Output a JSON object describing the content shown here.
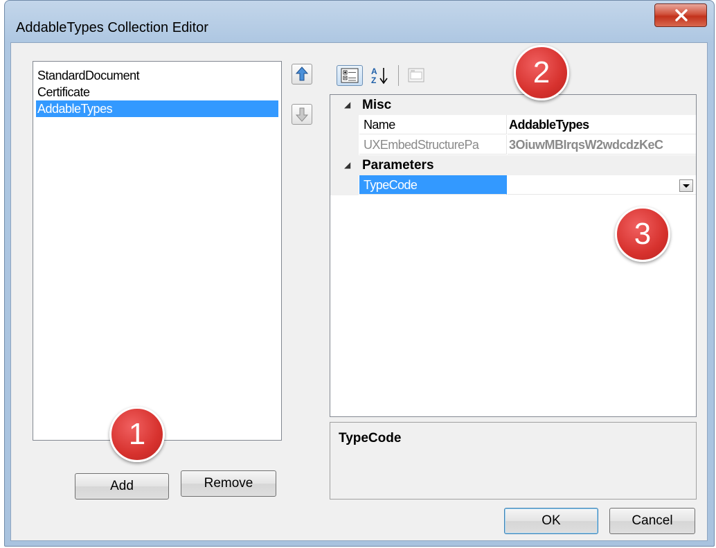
{
  "window": {
    "title": "AddableTypes Collection Editor",
    "close_icon": "close-icon"
  },
  "members": {
    "items": [
      {
        "label": "StandardDocument",
        "selected": false
      },
      {
        "label": "Certificate",
        "selected": false
      },
      {
        "label": "AddableTypes",
        "selected": true
      }
    ],
    "add_label": "Add",
    "remove_label": "Remove"
  },
  "property_grid": {
    "toolbar": {
      "categorized_icon": "categorized-icon",
      "alphabetical_icon": "sort-alphabetical-icon",
      "property_pages_icon": "property-pages-icon"
    },
    "categories": [
      {
        "label": "Misc",
        "properties": [
          {
            "name": "Name",
            "value": "AddableTypes",
            "readonly": false
          },
          {
            "name": "UXEmbedStructurePa",
            "value": "3OiuwMBIrqsW2wdcdzKeC",
            "readonly": true
          }
        ]
      },
      {
        "label": "Parameters",
        "properties": [
          {
            "name": "TypeCode",
            "value": "",
            "selected": true
          }
        ]
      }
    ],
    "description_title": "TypeCode"
  },
  "annotations": [
    "1",
    "2",
    "3"
  ],
  "footer": {
    "ok_label": "OK",
    "cancel_label": "Cancel"
  },
  "colors": {
    "selection": "#3399ff",
    "badge": "#d7322e",
    "frame": "#aec7e2"
  }
}
